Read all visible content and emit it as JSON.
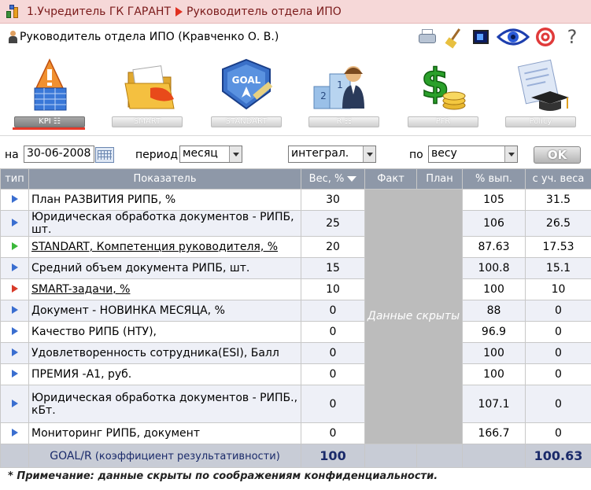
{
  "title": {
    "part1": "1.Учредитель ГК ГАРАНТ",
    "part2": "Руководитель отдела ИПО"
  },
  "user": {
    "label": "Руководитель отдела ИПО  (Кравченко О. В.)"
  },
  "tools": [
    "printer-icon",
    "broom-icon",
    "screen-icon",
    "eye-icon",
    "target-icon",
    "help-icon"
  ],
  "help_glyph": "?",
  "tabs": [
    {
      "label": "KPI",
      "active": true
    },
    {
      "label": "SMART",
      "active": false
    },
    {
      "label": "STANDART",
      "active": false
    },
    {
      "label": "R",
      "active": false
    },
    {
      "label": "PFR",
      "active": false
    },
    {
      "label": "Policy",
      "active": false
    }
  ],
  "goal_icon_text": "GOAL",
  "filters": {
    "date_label": "на",
    "date_value": "30-06-2008",
    "period_label": "период",
    "period_value": "месяц",
    "mode_value": "интеграл.",
    "sort_label": "по",
    "sort_value": "весу",
    "ok_label": "OK"
  },
  "table": {
    "headers": {
      "type": "тип",
      "name": "Показатель",
      "weight": "Вес, %",
      "fact": "Факт",
      "plan": "План",
      "pct": "% вып.",
      "weighted": "с уч. веса"
    },
    "hidden_text": "Данные скрыты",
    "rows": [
      {
        "marker": "blue",
        "name": "План РАЗВИТИЯ РИПБ, %",
        "link": false,
        "weight": "30",
        "pct": "105",
        "weighted": "31.5"
      },
      {
        "marker": "blue",
        "name": "Юридическая обработка документов - РИПБ, шт.",
        "link": false,
        "weight": "25",
        "pct": "106",
        "weighted": "26.5"
      },
      {
        "marker": "green",
        "name": "STANDART, Компетенция руководителя, %",
        "link": true,
        "weight": "20",
        "pct": "87.63",
        "weighted": "17.53"
      },
      {
        "marker": "blue",
        "name": "Средний объем документа РИПБ, шт.",
        "link": false,
        "weight": "15",
        "pct": "100.8",
        "weighted": "15.1"
      },
      {
        "marker": "red",
        "name": "SMART-задачи, %",
        "link": true,
        "weight": "10",
        "pct": "100",
        "weighted": "10"
      },
      {
        "marker": "blue",
        "name": "Документ - НОВИНКА МЕСЯЦА, %",
        "link": false,
        "weight": "0",
        "pct": "88",
        "weighted": "0"
      },
      {
        "marker": "blue",
        "name": "Качество РИПБ (НТУ),",
        "link": false,
        "weight": "0",
        "pct": "96.9",
        "weighted": "0"
      },
      {
        "marker": "blue",
        "name": "Удовлетворенность сотрудника(ESI), Балл",
        "link": false,
        "weight": "0",
        "pct": "100",
        "weighted": "0"
      },
      {
        "marker": "blue",
        "name": "ПРЕМИЯ -А1, руб.",
        "link": false,
        "weight": "0",
        "pct": "100",
        "weighted": "0"
      },
      {
        "marker": "blue",
        "name": "Юридическая обработка документов - РИПБ., кБт.",
        "link": false,
        "weight": "0",
        "pct": "107.1",
        "weighted": "0"
      },
      {
        "marker": "blue",
        "name": "Мониторинг РИПБ, документ",
        "link": false,
        "weight": "0",
        "pct": "166.7",
        "weighted": "0"
      }
    ],
    "footer": {
      "goal_main": "GOAL/R",
      "goal_sub": "(коэффициент результативности)",
      "weight_total": "100",
      "weighted_total": "100.63"
    }
  },
  "note": "* Примечание: данные скрыты по соображениям конфиденциальности."
}
